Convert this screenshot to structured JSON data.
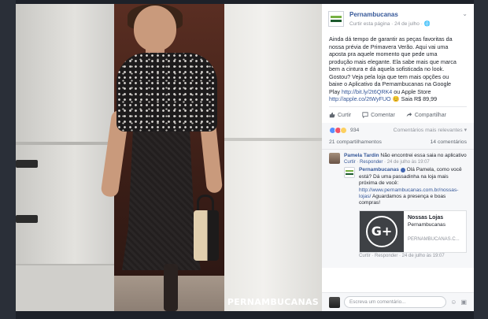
{
  "photo": {
    "watermark": "PERNAMBUCANAS"
  },
  "post": {
    "page_name": "Pernambucanas",
    "meta": "Curtir esta página · 24 de julho · ",
    "globe_icon": "globe-icon",
    "body_lines": [
      "Ainda dá tempo de garantir as peças favoritas da",
      "nossa prévia de Primavera Verão. Aqui vai uma",
      "aposta pra aquele momento que pede uma",
      "produção mais elegante. Ela sabe mais que marca",
      "bem a cintura e dá aquela sofisticada no look."
    ],
    "body_line6": "Gostou? Veja pela loja que tem mais opções ou",
    "body_line7": "baixe o Aplicativo da Pernambucanas na Google",
    "body_line8_prefix": "Play ",
    "link_play": "http://bit.ly/2t6QRK4",
    "body_line8_suffix": " ou Apple Store",
    "link_apple": "http://apple.co/2tWyFUO",
    "body_tail": " Saia R$ 89,99"
  },
  "actions": {
    "like": "Curtir",
    "comment": "Comentar",
    "share": "Compartilhar"
  },
  "reactions": {
    "count": "934",
    "relevance": "Comentários mais relevantes ▾"
  },
  "counts": {
    "shares": "21 compartilhamentos",
    "comments": "14 comentários"
  },
  "comments": {
    "c1_name": "Pamela Tardin",
    "c1_text": " Não encontrei essa saia no aplicativo",
    "c1_meta_like": "Curtir",
    "c1_meta_reply": "Responder",
    "c1_meta_date": " · 24 de julho às 19:07",
    "c2_name": "Pernambucanas",
    "c2_text": " Olá Pamela, como você está? Dá uma passadinha na loja mais próxima de você: ",
    "c2_link": "http://www.pernambucanas.com.br/nossas-lojas/",
    "c2_text2": " Aguardamos a presença e boas compras!",
    "card_title": "Nossas Lojas",
    "card_sub": "Pernambucanas",
    "card_domain": "PERNAMBUCANAS.C...",
    "c2_meta": "Curtir · Responder · 24 de julho às 19:07"
  },
  "composer": {
    "placeholder": "Escreva um comentário..."
  }
}
